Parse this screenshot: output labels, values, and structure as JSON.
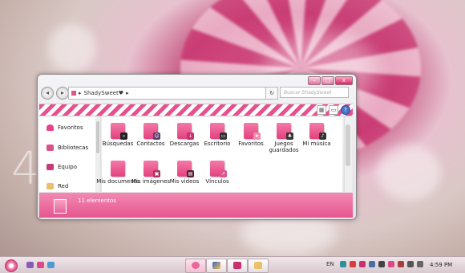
{
  "window": {
    "breadcrumb": "ShadySweet♥",
    "search_placeholder": "Buscar ShadySweet",
    "minimize_glyph": "–",
    "maximize_glyph": "□",
    "close_glyph": "x",
    "back_glyph": "◂",
    "forward_glyph": "▸",
    "breadcrumb_sep": "▸",
    "refresh_glyph": "↻",
    "help_glyph": "?"
  },
  "nav_pane": {
    "items": [
      {
        "label": "Favoritos",
        "icon": "heart-icon",
        "color": "#e8428b"
      },
      {
        "label": "Bibliotecas",
        "icon": "library-icon",
        "color": "#d9518b"
      },
      {
        "label": "Equipo",
        "icon": "computer-icon",
        "color": "#c33b7a"
      },
      {
        "label": "Red",
        "icon": "network-icon",
        "color": "#e9c16a"
      }
    ]
  },
  "folders": [
    {
      "label": "Búsquedas",
      "mark_color": "#222"
    },
    {
      "label": "Contactos",
      "mark_color": "#5a3d6e"
    },
    {
      "label": "Descargas",
      "mark_color": "#c8306e"
    },
    {
      "label": "Escritorio",
      "mark_color": "#333"
    },
    {
      "label": "Favoritos",
      "mark_color": "#f08aaf"
    },
    {
      "label": "Juegos guardados",
      "mark_color": "#333"
    },
    {
      "label": "Mi música",
      "mark_color": "#333"
    },
    {
      "label": "Mis documento",
      "mark_color": "#d94a86"
    },
    {
      "label": "Mis imágenes",
      "mark_color": "#b02f62"
    },
    {
      "label": "Mis videos",
      "mark_color": "#5a1d35"
    },
    {
      "label": "Vínculos",
      "mark_color": "#e05590"
    }
  ],
  "status": {
    "count_text": "11 elementos"
  },
  "taskbar": {
    "language": "EN",
    "clock": "4:59 PM"
  },
  "colors": {
    "accent": "#e6558f",
    "stripe": "#e7508f"
  }
}
